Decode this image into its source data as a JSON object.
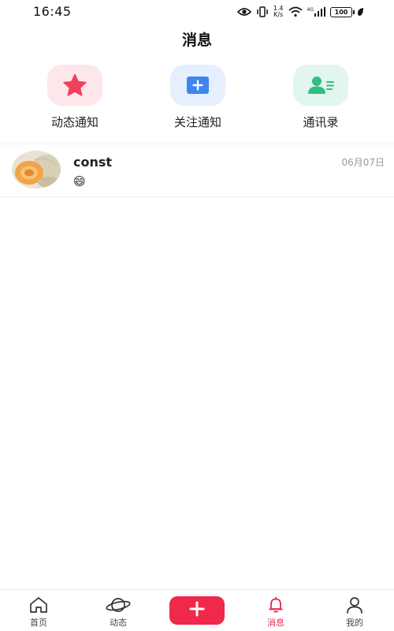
{
  "status_bar": {
    "time": "16:45",
    "net_speed_value": "1.4",
    "net_speed_unit": "K/s",
    "network_type": "4G",
    "battery": "100"
  },
  "header": {
    "title": "消息"
  },
  "quick_actions": [
    {
      "label": "动态通知",
      "icon": "star-icon",
      "color": "#f0405a"
    },
    {
      "label": "关注通知",
      "icon": "plus-square-icon",
      "color": "#3d86ee"
    },
    {
      "label": "通讯录",
      "icon": "contact-card-icon",
      "color": "#2fbf84"
    }
  ],
  "messages": [
    {
      "name": "const",
      "preview": "😄",
      "date": "06月07日",
      "avatar": "melon-avatar"
    }
  ],
  "bottom_nav": {
    "items": [
      {
        "label": "首页",
        "icon": "home-icon"
      },
      {
        "label": "动态",
        "icon": "planet-icon"
      },
      {
        "label": "",
        "icon": "plus-icon"
      },
      {
        "label": "消息",
        "icon": "bell-icon",
        "active": true
      },
      {
        "label": "我的",
        "icon": "user-icon"
      }
    ],
    "accent": "#f0284a"
  }
}
